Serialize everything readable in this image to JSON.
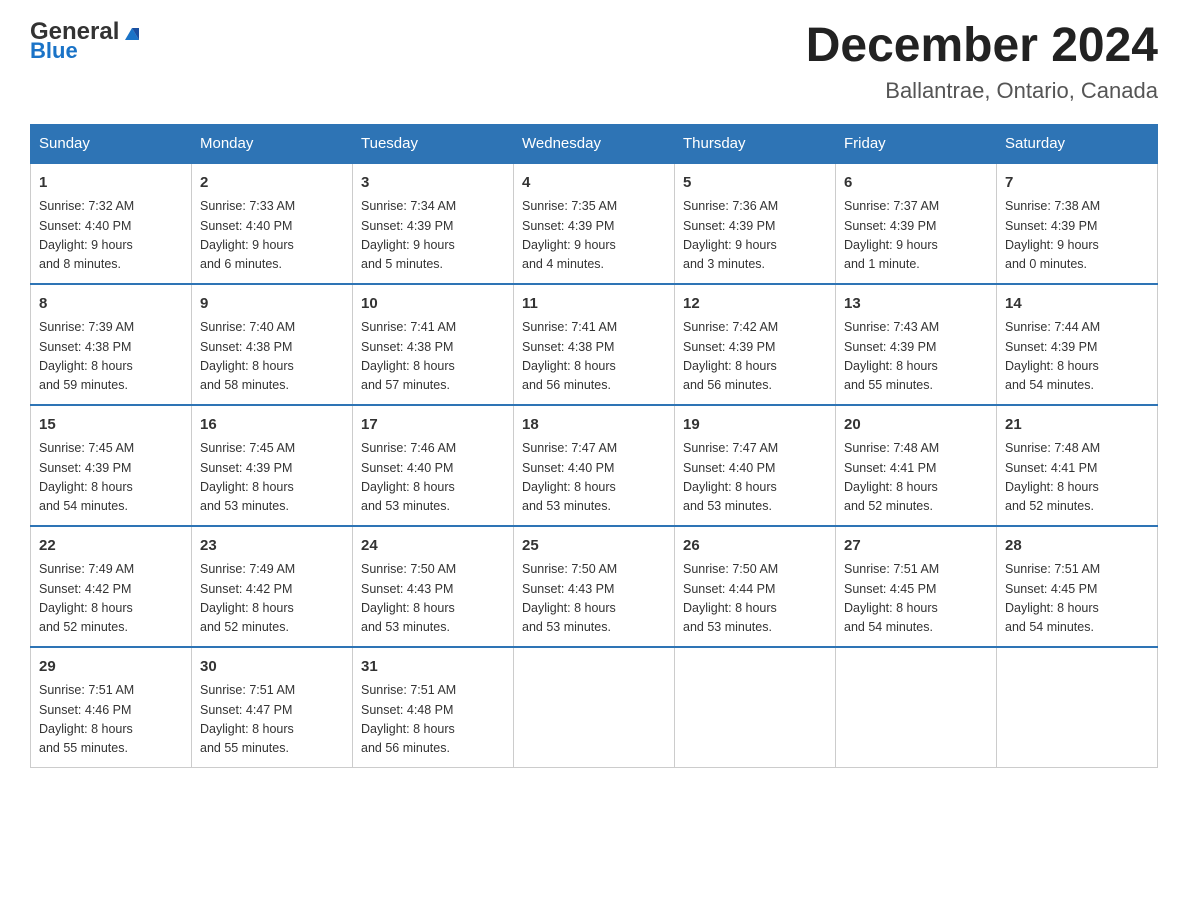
{
  "header": {
    "logo_general": "General",
    "logo_blue": "Blue",
    "month_title": "December 2024",
    "location": "Ballantrae, Ontario, Canada"
  },
  "days_of_week": [
    "Sunday",
    "Monday",
    "Tuesday",
    "Wednesday",
    "Thursday",
    "Friday",
    "Saturday"
  ],
  "weeks": [
    [
      {
        "day": "1",
        "sunrise": "7:32 AM",
        "sunset": "4:40 PM",
        "daylight": "9 hours and 8 minutes."
      },
      {
        "day": "2",
        "sunrise": "7:33 AM",
        "sunset": "4:40 PM",
        "daylight": "9 hours and 6 minutes."
      },
      {
        "day": "3",
        "sunrise": "7:34 AM",
        "sunset": "4:39 PM",
        "daylight": "9 hours and 5 minutes."
      },
      {
        "day": "4",
        "sunrise": "7:35 AM",
        "sunset": "4:39 PM",
        "daylight": "9 hours and 4 minutes."
      },
      {
        "day": "5",
        "sunrise": "7:36 AM",
        "sunset": "4:39 PM",
        "daylight": "9 hours and 3 minutes."
      },
      {
        "day": "6",
        "sunrise": "7:37 AM",
        "sunset": "4:39 PM",
        "daylight": "9 hours and 1 minute."
      },
      {
        "day": "7",
        "sunrise": "7:38 AM",
        "sunset": "4:39 PM",
        "daylight": "9 hours and 0 minutes."
      }
    ],
    [
      {
        "day": "8",
        "sunrise": "7:39 AM",
        "sunset": "4:38 PM",
        "daylight": "8 hours and 59 minutes."
      },
      {
        "day": "9",
        "sunrise": "7:40 AM",
        "sunset": "4:38 PM",
        "daylight": "8 hours and 58 minutes."
      },
      {
        "day": "10",
        "sunrise": "7:41 AM",
        "sunset": "4:38 PM",
        "daylight": "8 hours and 57 minutes."
      },
      {
        "day": "11",
        "sunrise": "7:41 AM",
        "sunset": "4:38 PM",
        "daylight": "8 hours and 56 minutes."
      },
      {
        "day": "12",
        "sunrise": "7:42 AM",
        "sunset": "4:39 PM",
        "daylight": "8 hours and 56 minutes."
      },
      {
        "day": "13",
        "sunrise": "7:43 AM",
        "sunset": "4:39 PM",
        "daylight": "8 hours and 55 minutes."
      },
      {
        "day": "14",
        "sunrise": "7:44 AM",
        "sunset": "4:39 PM",
        "daylight": "8 hours and 54 minutes."
      }
    ],
    [
      {
        "day": "15",
        "sunrise": "7:45 AM",
        "sunset": "4:39 PM",
        "daylight": "8 hours and 54 minutes."
      },
      {
        "day": "16",
        "sunrise": "7:45 AM",
        "sunset": "4:39 PM",
        "daylight": "8 hours and 53 minutes."
      },
      {
        "day": "17",
        "sunrise": "7:46 AM",
        "sunset": "4:40 PM",
        "daylight": "8 hours and 53 minutes."
      },
      {
        "day": "18",
        "sunrise": "7:47 AM",
        "sunset": "4:40 PM",
        "daylight": "8 hours and 53 minutes."
      },
      {
        "day": "19",
        "sunrise": "7:47 AM",
        "sunset": "4:40 PM",
        "daylight": "8 hours and 53 minutes."
      },
      {
        "day": "20",
        "sunrise": "7:48 AM",
        "sunset": "4:41 PM",
        "daylight": "8 hours and 52 minutes."
      },
      {
        "day": "21",
        "sunrise": "7:48 AM",
        "sunset": "4:41 PM",
        "daylight": "8 hours and 52 minutes."
      }
    ],
    [
      {
        "day": "22",
        "sunrise": "7:49 AM",
        "sunset": "4:42 PM",
        "daylight": "8 hours and 52 minutes."
      },
      {
        "day": "23",
        "sunrise": "7:49 AM",
        "sunset": "4:42 PM",
        "daylight": "8 hours and 52 minutes."
      },
      {
        "day": "24",
        "sunrise": "7:50 AM",
        "sunset": "4:43 PM",
        "daylight": "8 hours and 53 minutes."
      },
      {
        "day": "25",
        "sunrise": "7:50 AM",
        "sunset": "4:43 PM",
        "daylight": "8 hours and 53 minutes."
      },
      {
        "day": "26",
        "sunrise": "7:50 AM",
        "sunset": "4:44 PM",
        "daylight": "8 hours and 53 minutes."
      },
      {
        "day": "27",
        "sunrise": "7:51 AM",
        "sunset": "4:45 PM",
        "daylight": "8 hours and 54 minutes."
      },
      {
        "day": "28",
        "sunrise": "7:51 AM",
        "sunset": "4:45 PM",
        "daylight": "8 hours and 54 minutes."
      }
    ],
    [
      {
        "day": "29",
        "sunrise": "7:51 AM",
        "sunset": "4:46 PM",
        "daylight": "8 hours and 55 minutes."
      },
      {
        "day": "30",
        "sunrise": "7:51 AM",
        "sunset": "4:47 PM",
        "daylight": "8 hours and 55 minutes."
      },
      {
        "day": "31",
        "sunrise": "7:51 AM",
        "sunset": "4:48 PM",
        "daylight": "8 hours and 56 minutes."
      },
      null,
      null,
      null,
      null
    ]
  ]
}
